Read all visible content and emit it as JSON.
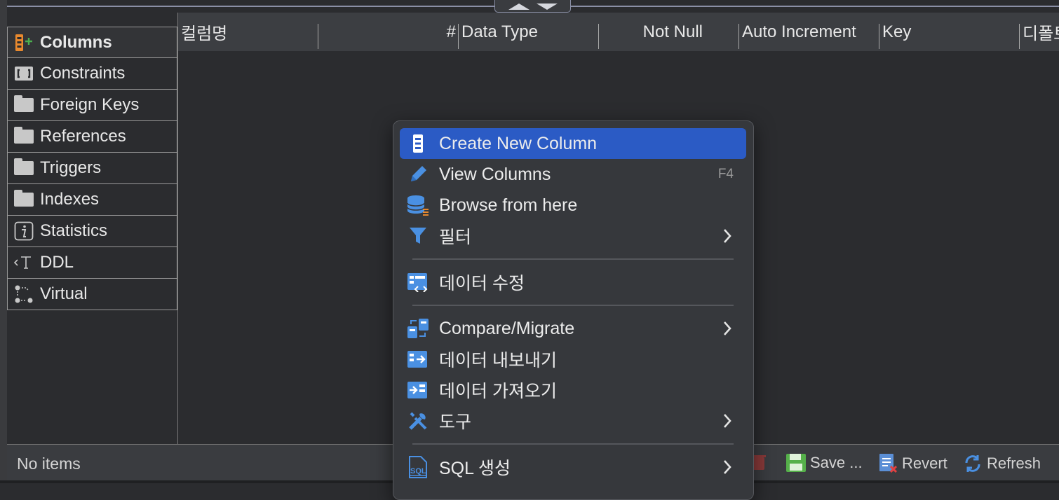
{
  "sidebar": {
    "items": [
      {
        "label": "Columns",
        "icon": "columns-add-icon",
        "active": true
      },
      {
        "label": "Constraints",
        "icon": "constraints-icon"
      },
      {
        "label": "Foreign Keys",
        "icon": "folder-icon"
      },
      {
        "label": "References",
        "icon": "folder-icon"
      },
      {
        "label": "Triggers",
        "icon": "folder-icon"
      },
      {
        "label": "Indexes",
        "icon": "folder-icon"
      },
      {
        "label": "Statistics",
        "icon": "info-icon"
      },
      {
        "label": "DDL",
        "icon": "ddl-icon"
      },
      {
        "label": "Virtual",
        "icon": "virtual-icon"
      }
    ]
  },
  "grid": {
    "columns": [
      "컬럼명",
      "#",
      "Data Type",
      "Not Null",
      "Auto Increment",
      "Key",
      "디폴트"
    ]
  },
  "status": {
    "text": "No items",
    "save_label": "Save ...",
    "revert_label": "Revert",
    "refresh_label": "Refresh"
  },
  "context_menu": {
    "items": [
      {
        "label": "Create New Column",
        "icon": "column-icon",
        "highlighted": true
      },
      {
        "label": "View Columns",
        "icon": "pencil-icon",
        "shortcut": "F4"
      },
      {
        "label": "Browse from here",
        "icon": "database-icon"
      },
      {
        "label": "필터",
        "icon": "filter-icon",
        "submenu": true
      },
      {
        "label": "데이터 수정",
        "icon": "edit-data-icon"
      },
      {
        "label": "Compare/Migrate",
        "icon": "compare-icon",
        "submenu": true
      },
      {
        "label": "데이터 내보내기",
        "icon": "export-icon"
      },
      {
        "label": "데이터 가져오기",
        "icon": "import-icon"
      },
      {
        "label": "도구",
        "icon": "tools-icon",
        "submenu": true
      },
      {
        "label": "SQL 생성",
        "icon": "sql-icon",
        "submenu": true
      }
    ]
  },
  "colors": {
    "highlight": "#2b5bc5",
    "accent_orange": "#e8892e",
    "accent_blue": "#4a90e2"
  }
}
